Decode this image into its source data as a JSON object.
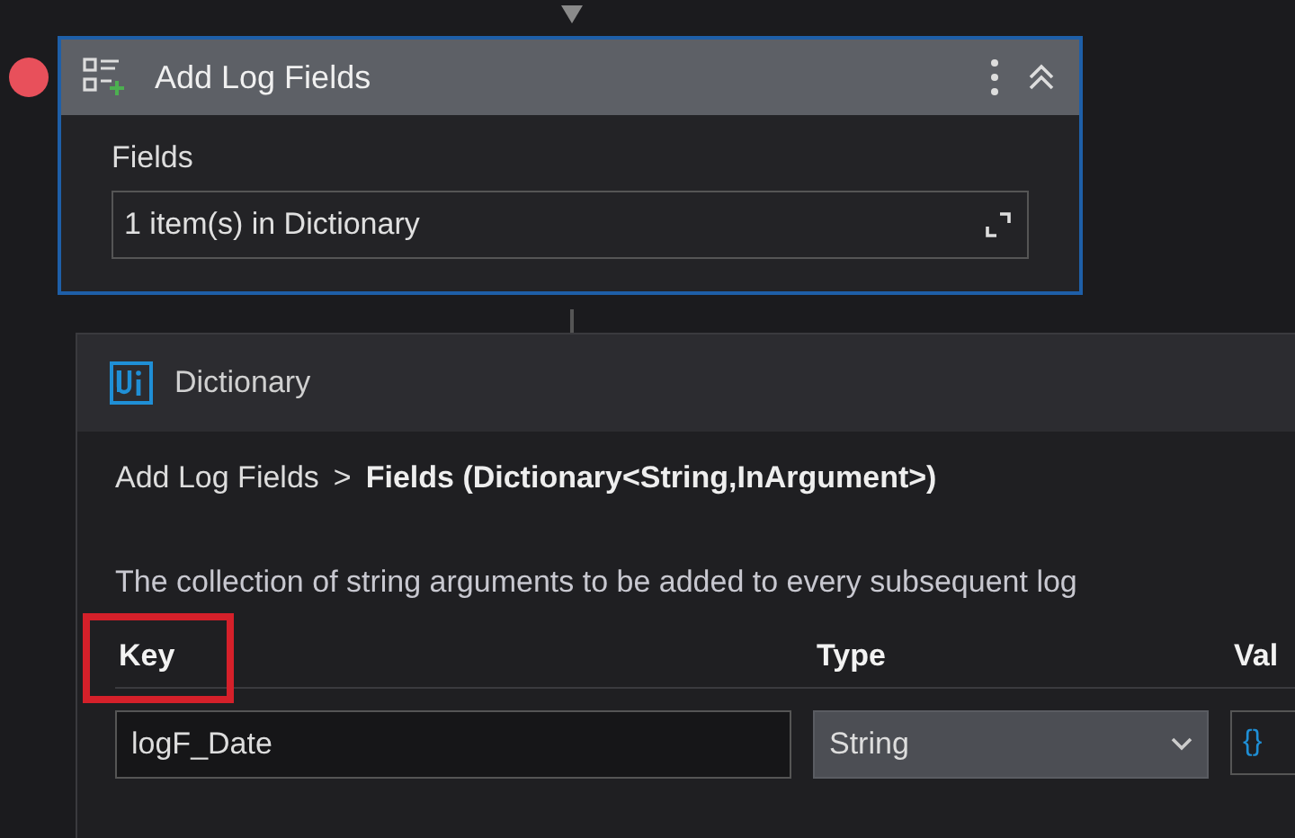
{
  "activity": {
    "title": "Add Log Fields",
    "breakpoint": true,
    "property_label": "Fields",
    "property_value": "1 item(s) in Dictionary"
  },
  "dialog": {
    "title": "Dictionary",
    "breadcrumb": {
      "parent": "Add Log Fields",
      "separator": ">",
      "current": "Fields (Dictionary<String,InArgument>)"
    },
    "description": "The collection of string arguments to be added to every subsequent log",
    "columns": [
      {
        "label": "Key",
        "highlighted": true
      },
      {
        "label": "Type",
        "highlighted": false
      },
      {
        "label": "Val",
        "highlighted": false
      }
    ],
    "rows": [
      {
        "key": "logF_Date",
        "type": "String",
        "value": "{}"
      }
    ]
  }
}
